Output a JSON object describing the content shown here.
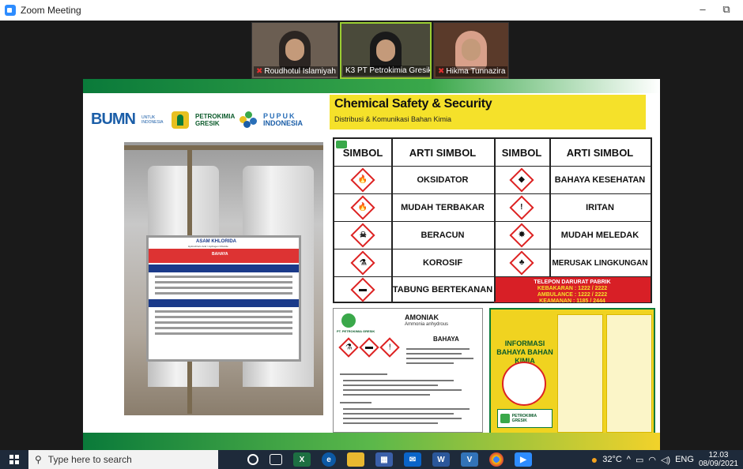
{
  "window": {
    "title": "Zoom Meeting",
    "minimize": "–",
    "restore": "⧉"
  },
  "participants": [
    {
      "name": "Roudhotul Islamiyah",
      "muted": true
    },
    {
      "name": "K3 PT Petrokimia Gresik",
      "muted": true
    },
    {
      "name": "Hikma Tunnazira",
      "muted": true
    }
  ],
  "slide": {
    "logos": {
      "bumn": "BUMN",
      "bumn_sub": "UNTUK INDONESIA",
      "petrokimia": "PETROKIMIA GRESIK",
      "pupuk": "PUPUK",
      "indonesia": "INDONESIA"
    },
    "title": "Chemical Safety & Security",
    "subtitle": "Distribusi & Komunikasi Bahan Kimia",
    "photo_board": {
      "title": "ASAM KHLORIDA",
      "sub": "Hydrochloric Acid / Hydrogen Chloride",
      "bahaya": "BAHAYA"
    },
    "table": {
      "headers": [
        "SIMBOL",
        "ARTI SIMBOL",
        "SIMBOL",
        "ARTI SIMBOL"
      ],
      "rows": [
        {
          "left_icon": "🔥",
          "left": "OKSIDATOR",
          "right_icon": "◆",
          "right": "BAHAYA KESEHATAN"
        },
        {
          "left_icon": "🔥",
          "left": "MUDAH TERBAKAR",
          "right_icon": "!",
          "right": "IRITAN"
        },
        {
          "left_icon": "☠",
          "left": "BERACUN",
          "right_icon": "✸",
          "right": "MUDAH MELEDAK"
        },
        {
          "left_icon": "⚗",
          "left": "KOROSIF",
          "right_icon": "♣",
          "right": "MERUSAK LINGKUNGAN"
        },
        {
          "left_icon": "▬",
          "left": "TABUNG BERTEKANAN"
        }
      ],
      "emergency": {
        "title": "TELEPON DARURAT PABRIK",
        "kebakaran": "KEBAKARAN  : 1222 / 2222",
        "ambulance": "AMBULANCE  : 1222 / 2222",
        "keamanan": "KEAMANAN   : 1185 / 2444"
      }
    },
    "amoniak": {
      "title": "AMONIAK",
      "sub": "Ammonia anhydrous",
      "bahaya": "BAHAYA",
      "company": "PT. PETROKIMIA GRESIK"
    },
    "infobox": {
      "title": "INFORMASI BAHAYA BAHAN KIMIA",
      "company": "PETROKIMIA GRESIK"
    }
  },
  "taskbar": {
    "search_placeholder": "Type here to search",
    "temperature": "32°C",
    "lang": "ENG",
    "time": "12.03",
    "date": "08/09/2021"
  }
}
